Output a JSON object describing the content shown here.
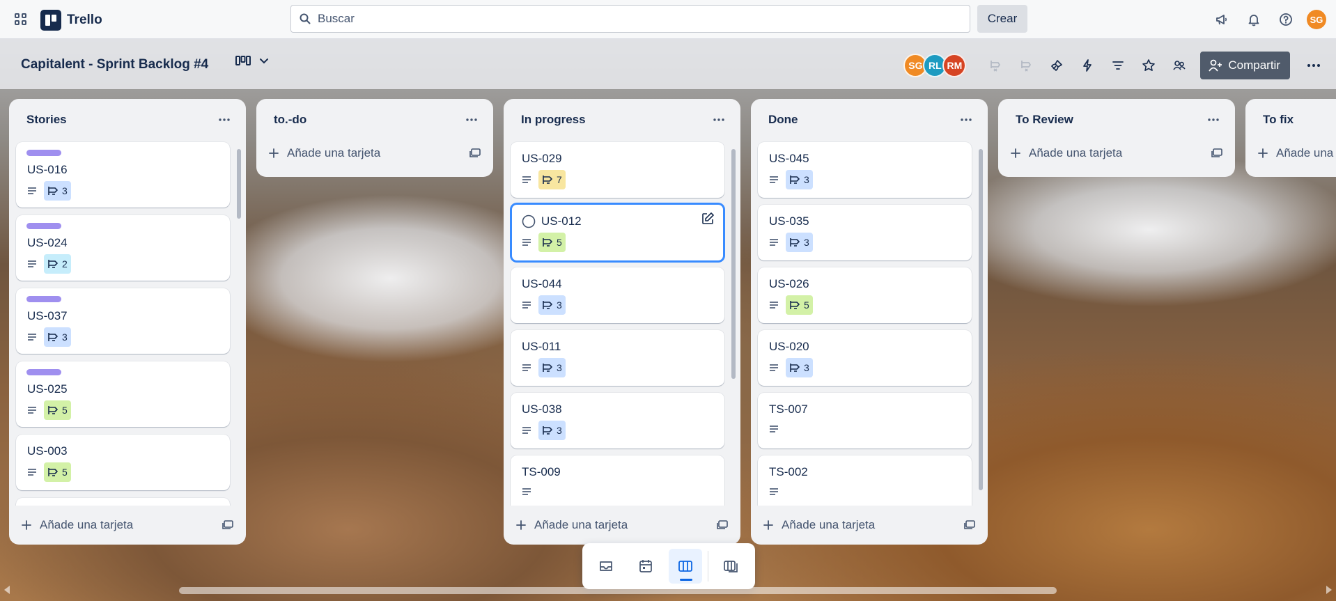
{
  "app": {
    "name": "Trello"
  },
  "search": {
    "placeholder": "Buscar"
  },
  "create_label": "Crear",
  "user_avatar": "SG",
  "board": {
    "title": "Capitalent - Sprint Backlog #4",
    "members": [
      "SG",
      "RL",
      "RM"
    ],
    "share_label": "Compartir"
  },
  "add_card_label": "Añade una tarjeta",
  "lists": [
    {
      "title": "Stories",
      "cards": [
        {
          "title": "US-016",
          "label": true,
          "points": "3",
          "badge_color": "blue"
        },
        {
          "title": "US-024",
          "label": true,
          "points": "2",
          "badge_color": "cyan"
        },
        {
          "title": "US-037",
          "label": true,
          "points": "3",
          "badge_color": "blue"
        },
        {
          "title": "US-025",
          "label": true,
          "points": "5",
          "badge_color": "green"
        },
        {
          "title": "US-003",
          "label": false,
          "points": "5",
          "badge_color": "green"
        }
      ]
    },
    {
      "title": "to.-do",
      "cards": []
    },
    {
      "title": "In progress",
      "cards": [
        {
          "title": "US-029",
          "points": "7",
          "badge_color": "yellow"
        },
        {
          "title": "US-012",
          "points": "5",
          "badge_color": "green",
          "focused": true
        },
        {
          "title": "US-044",
          "points": "3",
          "badge_color": "blue"
        },
        {
          "title": "US-011",
          "points": "3",
          "badge_color": "blue"
        },
        {
          "title": "US-038",
          "points": "3",
          "badge_color": "blue"
        },
        {
          "title": "TS-009",
          "points": null
        }
      ]
    },
    {
      "title": "Done",
      "cards": [
        {
          "title": "US-045",
          "points": "3",
          "badge_color": "blue"
        },
        {
          "title": "US-035",
          "points": "3",
          "badge_color": "blue"
        },
        {
          "title": "US-026",
          "points": "5",
          "badge_color": "green"
        },
        {
          "title": "US-020",
          "points": "3",
          "badge_color": "blue"
        },
        {
          "title": "TS-007",
          "points": null
        },
        {
          "title": "TS-002",
          "points": null
        }
      ]
    },
    {
      "title": "To Review",
      "cards": []
    },
    {
      "title": "To fix",
      "cards": []
    }
  ],
  "colors": {
    "label_purple": "#9f8fef",
    "share_bg": "#505b6b",
    "focus_border": "#388bff"
  }
}
